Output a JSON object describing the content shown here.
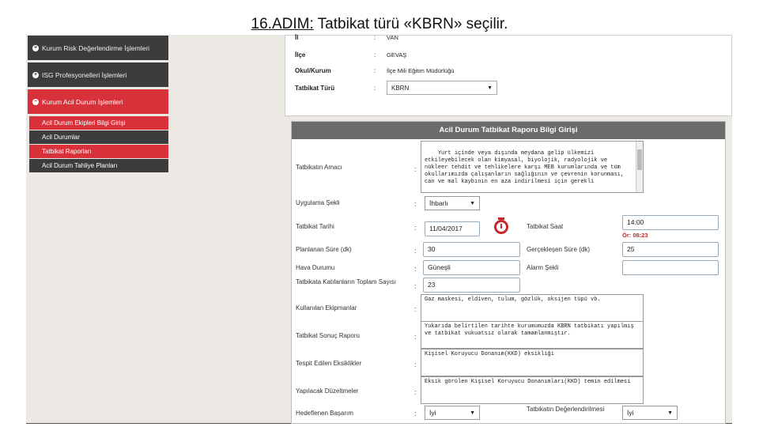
{
  "slide": {
    "title_prefix": "16.ADIM:",
    "title_rest": " Tatbikat türü «KBRN» seçilir."
  },
  "sidebar": {
    "items": [
      {
        "label": "Kurum Risk Değerlendirme İşlemleri",
        "icon": "plus-circle-icon"
      },
      {
        "label": "ISG Profesyonelleri İşlemleri",
        "icon": "plus-circle-icon"
      },
      {
        "label": "Kurum Acil Durum İşlemleri",
        "icon": "minus-circle-icon"
      }
    ],
    "subitems": [
      {
        "label": "Acil Durum Ekipleri Bilgi Girişi"
      },
      {
        "label": "Acil Durumlar"
      },
      {
        "label": "Tatbikat Raporları"
      },
      {
        "label": "Acil Durum Tahliye Planları"
      }
    ]
  },
  "info": {
    "il": {
      "label": "İl",
      "value": "VAN"
    },
    "ilce": {
      "label": "İlçe",
      "value": "GEVAŞ"
    },
    "okul": {
      "label": "Okul/Kurum",
      "value": "İlçe Mili Eğitim Müdürlüğü"
    },
    "tatbikat_turu": {
      "label": "Tatbikat Türü",
      "value": "KBRN"
    },
    "colon": ":"
  },
  "form": {
    "header": "Acil Durum Tatbikat Raporu Bilgi Girişi",
    "amac": {
      "label": "Tatbikatın Amacı",
      "value": "Yurt içinde veya dışında meydana gelip ülkemizi etkileyebilecek olan kimyasal, biyolojik, radyolojik ve nükleer tehdit ve tehlikelere karşı MEB kurumlarında ve tüm okullarımızda çalışanların sağlığının ve çevrenin korunması, can ve mal kaybının en aza indirilmesi için gerekli"
    },
    "uygulama_sekli": {
      "label": "Uygulama Şekli",
      "value": "İhbarlı"
    },
    "tarih": {
      "label": "Tatbikat Tarihi",
      "value": "11/04/2017"
    },
    "saat": {
      "label": "Tatbikat Saat",
      "value": "14:00",
      "note": "Ör: 08:23"
    },
    "planlanan": {
      "label": "Planlanan Süre (dk)",
      "value": "30"
    },
    "gerceklesen": {
      "label": "Gerçekleşen Süre (dk)",
      "value": "25"
    },
    "hava": {
      "label": "Hava Durumu",
      "value": "Güneşli"
    },
    "alarm": {
      "label": "Alarm Şekli",
      "value": ""
    },
    "katilan": {
      "label": "Tatbikata Katılanların Toplam Sayısı",
      "value": "23"
    },
    "ekipman": {
      "label": "Kullanılan Ekipmanlar",
      "value": "Gaz maskesi, eldiven, tulum, gözlük, oksijen tüpü vb."
    },
    "sonuc": {
      "label": "Tatbikat Sonuç Raporu",
      "value": "Yukarıda belirtilen tarihte kurumumuzda KBRN tatbikatı yapılmış ve tatbikat vukuatsız olarak tamamlanmıştır."
    },
    "eksiklik": {
      "label": "Tespit Edilen Eksiklikler",
      "value": "Kişisel Koruyucu Donanım(KKD) eksikliği"
    },
    "duzeltme": {
      "label": "Yapılacak Düzeltmeler",
      "value": "Eksik görülen Kişisel Koruyucu Donanımları(KKD) temin edilmesi"
    },
    "basari": {
      "label": "Hedeflenen Başarım",
      "value": "İyi"
    },
    "degerlendirme": {
      "label": "Tatbikatın Değerlendirilmesi",
      "value": "İyi"
    },
    "colon": ":"
  },
  "colors": {
    "accent": "#d8313a",
    "sidebar": "#3c3c3c",
    "header": "#6b6b6b"
  }
}
